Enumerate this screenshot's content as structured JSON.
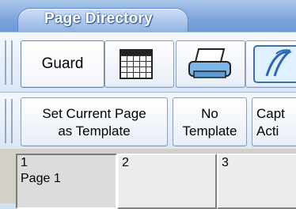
{
  "window": {
    "title": "Page Directory"
  },
  "toolbar_row1": {
    "guard_label": "Guard",
    "icons": [
      "grid-icon",
      "printer-icon",
      "wizard-icon"
    ]
  },
  "toolbar_row2": {
    "set_template_line1": "Set Current Page",
    "set_template_line2": "as Template",
    "no_template_line1": "No",
    "no_template_line2": "Template",
    "capture_line1": "Capt",
    "capture_line2": "Acti"
  },
  "pages": [
    {
      "number": "1",
      "label": "Page 1",
      "selected": true
    },
    {
      "number": "2",
      "label": ""
    },
    {
      "number": "3",
      "label": ""
    }
  ],
  "colors": {
    "title_bar": "#5d8ed3",
    "toolbar_bg": "#dbe7f5",
    "grid_bg": "#ececec"
  }
}
